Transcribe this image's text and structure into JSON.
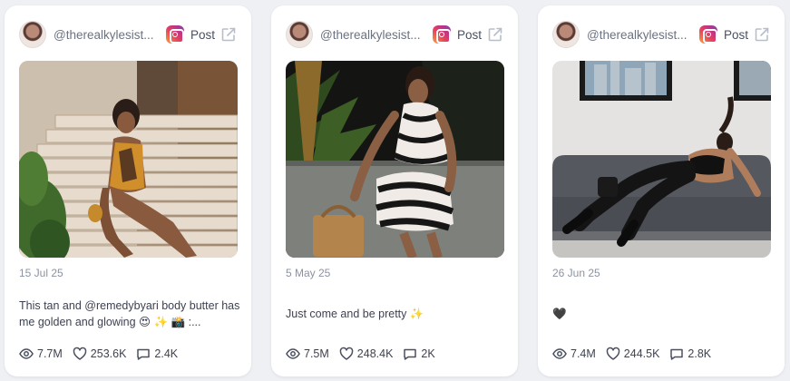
{
  "posts": [
    {
      "handle": "@therealkylesist...",
      "type_label": "Post",
      "date": "15 Jul 25",
      "caption": "This tan and @remedybyari body butter has me golden and glowing 😍 ✨ 📸 :...",
      "views": "7.7M",
      "likes": "253.6K",
      "comments": "2.4K"
    },
    {
      "handle": "@therealkylesist...",
      "type_label": "Post",
      "date": "5 May 25",
      "caption": "Just come and be pretty ✨",
      "views": "7.5M",
      "likes": "248.4K",
      "comments": "2K"
    },
    {
      "handle": "@therealkylesist...",
      "type_label": "Post",
      "date": "26 Jun 25",
      "caption": "🖤",
      "views": "7.4M",
      "likes": "244.5K",
      "comments": "2.8K"
    }
  ],
  "icons": {
    "platform": "instagram-icon",
    "open": "external-link-icon",
    "views": "eye-icon",
    "likes": "heart-icon",
    "comments": "comment-icon"
  },
  "colors": {
    "background": "#eef0f4",
    "card": "#ffffff",
    "muted_text": "#8b92a0",
    "body_text": "#3d4250"
  }
}
